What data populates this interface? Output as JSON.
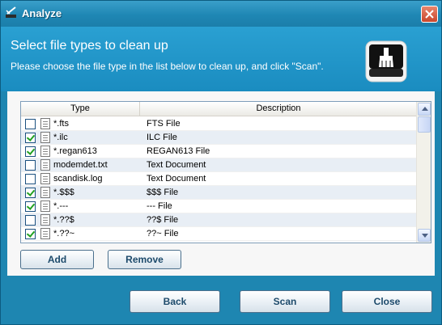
{
  "window": {
    "title": "Analyze",
    "close_glyph": "×"
  },
  "header": {
    "title": "Select file types to clean up",
    "subtitle": "Please choose the file type in the list below to clean up, and click \"Scan\".",
    "icon": "broom-drive-icon"
  },
  "list": {
    "columns": [
      "Type",
      "Description"
    ],
    "rows": [
      {
        "checked": false,
        "type": "*.fts",
        "description": "FTS File"
      },
      {
        "checked": true,
        "type": "*.ilc",
        "description": "ILC File"
      },
      {
        "checked": true,
        "type": "*.regan613",
        "description": "REGAN613 File"
      },
      {
        "checked": false,
        "type": "modemdet.txt",
        "description": "Text Document"
      },
      {
        "checked": false,
        "type": "scandisk.log",
        "description": "Text Document"
      },
      {
        "checked": true,
        "type": "*.$$$",
        "description": "$$$ File"
      },
      {
        "checked": true,
        "type": "*.---",
        "description": "--- File"
      },
      {
        "checked": false,
        "type": "*.??$",
        "description": "??$ File"
      },
      {
        "checked": true,
        "type": "*.??~",
        "description": "??~ File"
      }
    ]
  },
  "buttons": {
    "add": "Add",
    "remove": "Remove",
    "back": "Back",
    "scan": "Scan",
    "close": "Close"
  },
  "colors": {
    "accent": "#1e86b1",
    "header": "#2aa0d2",
    "check": "#21a121"
  }
}
